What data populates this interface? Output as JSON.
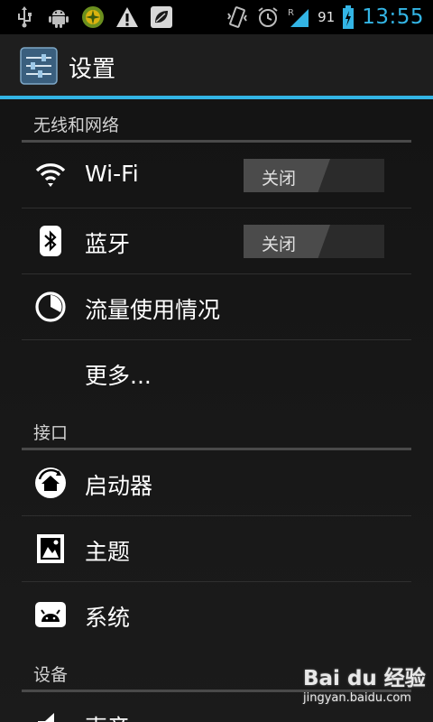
{
  "status_bar": {
    "icons_left": [
      "usb-icon",
      "android-debug-icon",
      "app-notification-icon",
      "warning-icon",
      "leaf-app-icon"
    ],
    "icons_right": [
      "vibrate-icon",
      "alarm-icon",
      "signal-roaming-icon",
      "battery-charging-icon"
    ],
    "battery_level": "91",
    "time": "13:55",
    "accent_color": "#33b5e5"
  },
  "action_bar": {
    "title": "设置",
    "icon": "settings-sliders-icon"
  },
  "sections": [
    {
      "header": "无线和网络",
      "items": [
        {
          "label": "Wi-Fi",
          "icon": "wifi-icon",
          "toggle": "关闭"
        },
        {
          "label": "蓝牙",
          "icon": "bluetooth-icon",
          "toggle": "关闭"
        },
        {
          "label": "流量使用情况",
          "icon": "data-usage-icon"
        },
        {
          "label": "更多..."
        }
      ]
    },
    {
      "header": "接口",
      "items": [
        {
          "label": "启动器",
          "icon": "launcher-icon"
        },
        {
          "label": "主题",
          "icon": "theme-icon"
        },
        {
          "label": "系统",
          "icon": "system-icon"
        }
      ]
    },
    {
      "header": "设备",
      "items": [
        {
          "label": "声音",
          "icon": "sound-icon"
        }
      ]
    }
  ],
  "watermark": {
    "logo": "Bai du 经验",
    "url": "jingyan.baidu.com"
  }
}
